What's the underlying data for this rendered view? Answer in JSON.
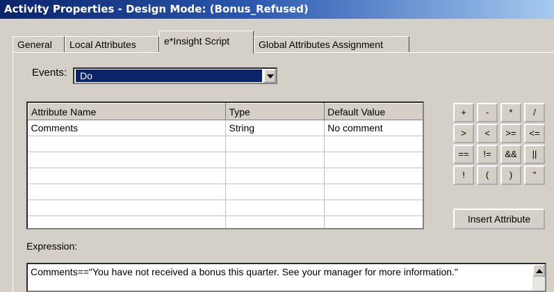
{
  "window": {
    "title": "Activity Properties - Design Mode: (Bonus_Refused)"
  },
  "tabs": [
    {
      "label": "General"
    },
    {
      "label": "Local Attributes"
    },
    {
      "label": "e*Insight Script"
    },
    {
      "label": "Global Attributes Assignment"
    }
  ],
  "active_tab": "e*Insight Script",
  "events": {
    "label": "Events:",
    "selected": "Do"
  },
  "grid": {
    "columns": [
      "Attribute Name",
      "Type",
      "Default Value"
    ],
    "rows": [
      [
        "Comments",
        "String",
        "No comment"
      ],
      [
        "",
        "",
        ""
      ],
      [
        "",
        "",
        ""
      ],
      [
        "",
        "",
        ""
      ],
      [
        "",
        "",
        ""
      ],
      [
        "",
        "",
        ""
      ],
      [
        "",
        "",
        ""
      ],
      [
        "",
        "",
        ""
      ]
    ]
  },
  "operators": [
    [
      "+",
      "-",
      "*",
      "/"
    ],
    [
      ">",
      "<",
      ">=",
      "<="
    ],
    [
      "==",
      "!=",
      "&&",
      "||"
    ],
    [
      "!",
      "(",
      ")",
      "\""
    ]
  ],
  "insert_button": {
    "label": "Insert Attribute"
  },
  "expression": {
    "label": "Expression:",
    "value": "Comments==\"You have not received a bonus this quarter.  See your manager for more information.\""
  }
}
